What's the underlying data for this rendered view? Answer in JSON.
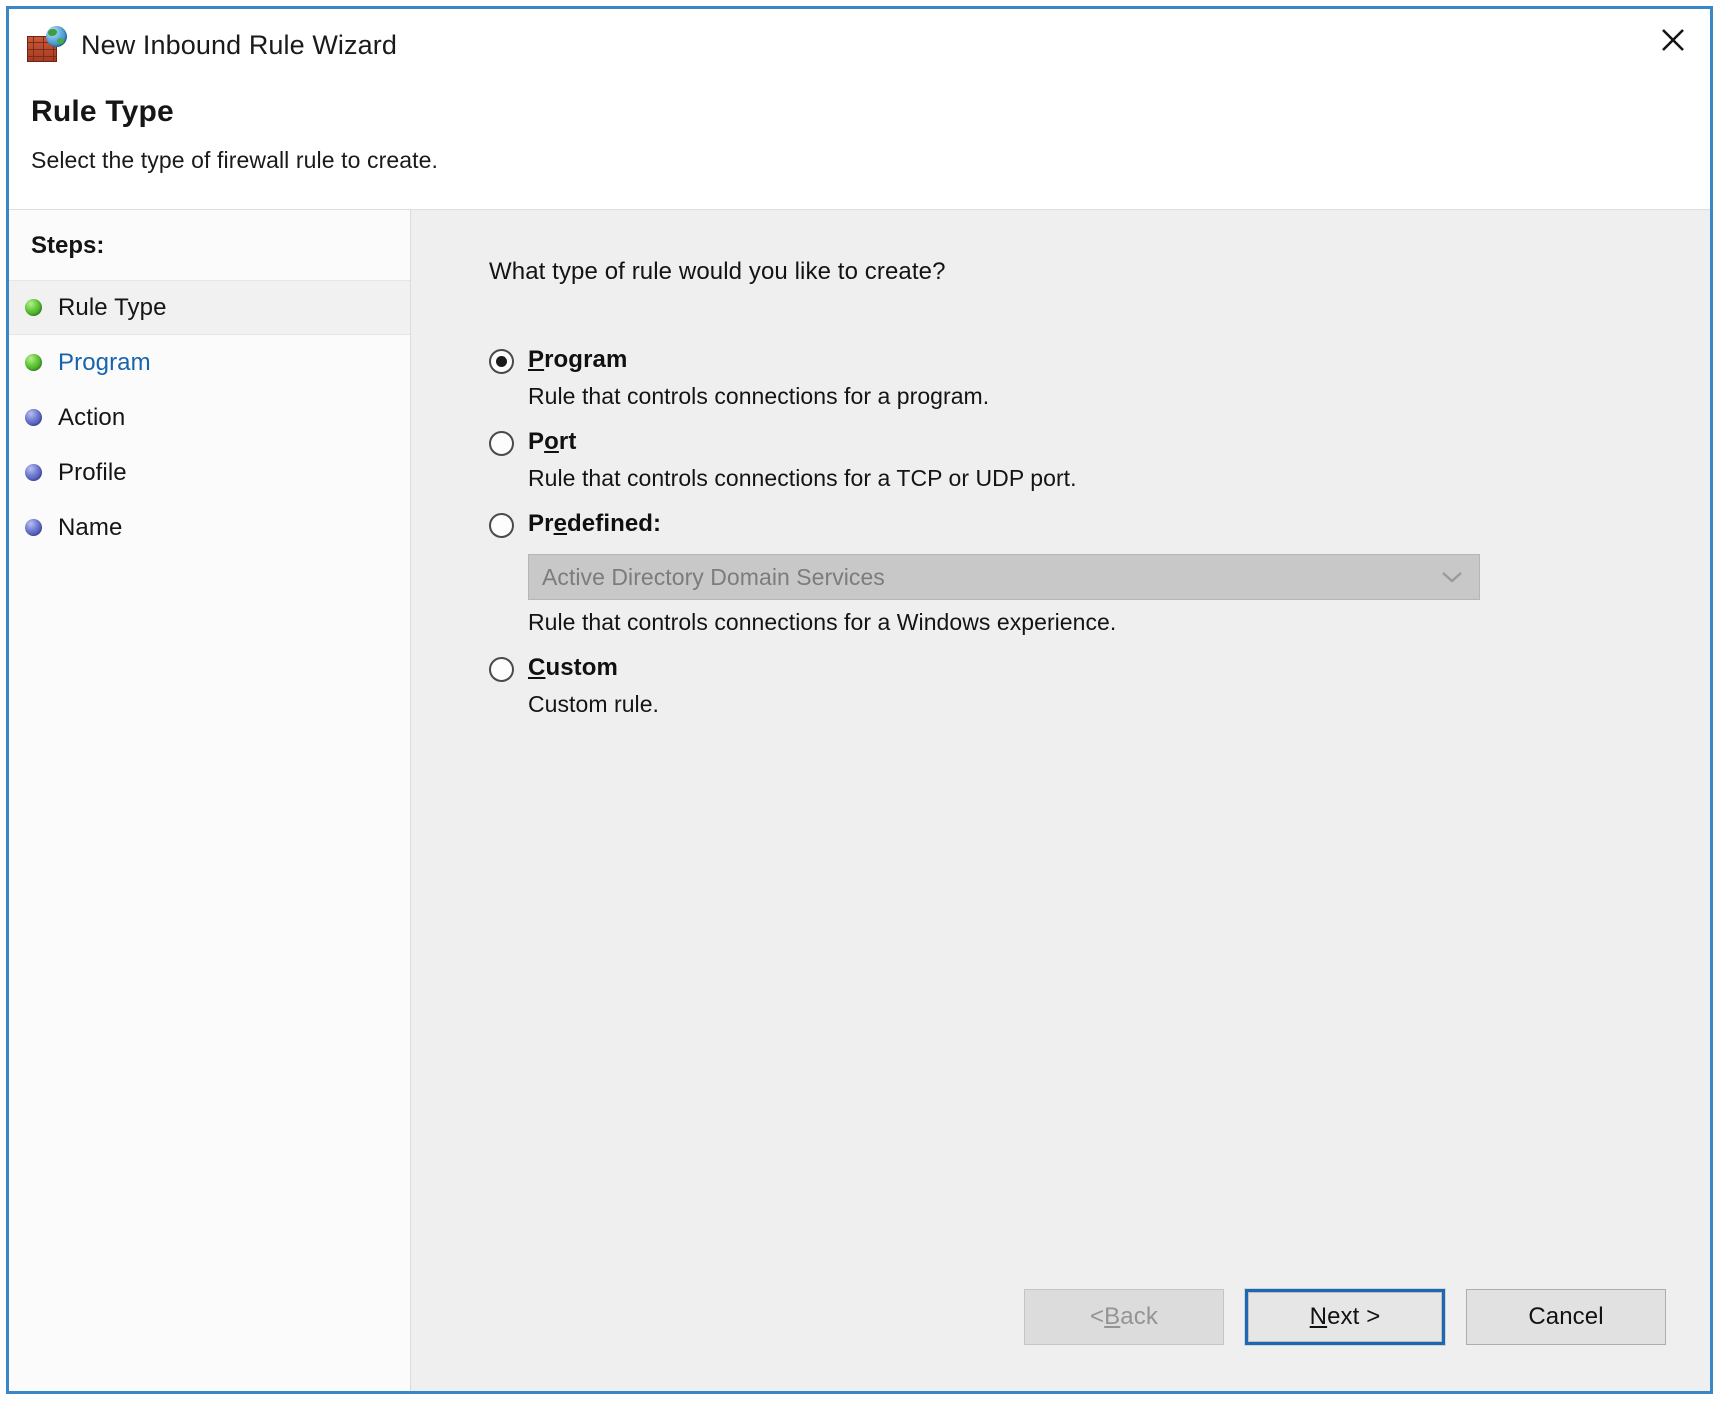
{
  "window": {
    "title": "New Inbound Rule Wizard",
    "icon": "firewall-globe-icon",
    "close_label": "✕",
    "border_color": "#3a87c8"
  },
  "header": {
    "page_title": "Rule Type",
    "subtitle": "Select the type of firewall rule to create."
  },
  "sidebar": {
    "heading": "Steps:",
    "items": [
      {
        "label": "Rule Type",
        "bullet": "green",
        "state": "current"
      },
      {
        "label": "Program",
        "bullet": "green",
        "state": "link"
      },
      {
        "label": "Action",
        "bullet": "blue",
        "state": "pending"
      },
      {
        "label": "Profile",
        "bullet": "blue",
        "state": "pending"
      },
      {
        "label": "Name",
        "bullet": "blue",
        "state": "pending"
      }
    ]
  },
  "main": {
    "question": "What type of rule would you like to create?",
    "options": [
      {
        "label_pre": "",
        "label_accel": "P",
        "label_post": "rogram",
        "description": "Rule that controls connections for a program.",
        "selected": true
      },
      {
        "label_pre": "P",
        "label_accel": "o",
        "label_post": "rt",
        "description": "Rule that controls connections for a TCP or UDP port.",
        "selected": false
      },
      {
        "label_pre": "Pr",
        "label_accel": "e",
        "label_post": "defined:",
        "description": "Rule that controls connections for a Windows experience.",
        "selected": false,
        "combo": {
          "value": "Active Directory Domain Services",
          "enabled": false,
          "arrow_icon": "chevron-down-icon"
        }
      },
      {
        "label_pre": "",
        "label_accel": "C",
        "label_post": "ustom",
        "description": "Custom rule.",
        "selected": false
      }
    ]
  },
  "footer": {
    "buttons": [
      {
        "pre": "< ",
        "accel": "B",
        "post": "ack",
        "state": "disabled",
        "name": "back-button"
      },
      {
        "pre": "",
        "accel": "N",
        "post": "ext >",
        "state": "default",
        "name": "next-button"
      },
      {
        "pre": "Cancel",
        "accel": "",
        "post": "",
        "state": "normal",
        "name": "cancel-button"
      }
    ]
  }
}
